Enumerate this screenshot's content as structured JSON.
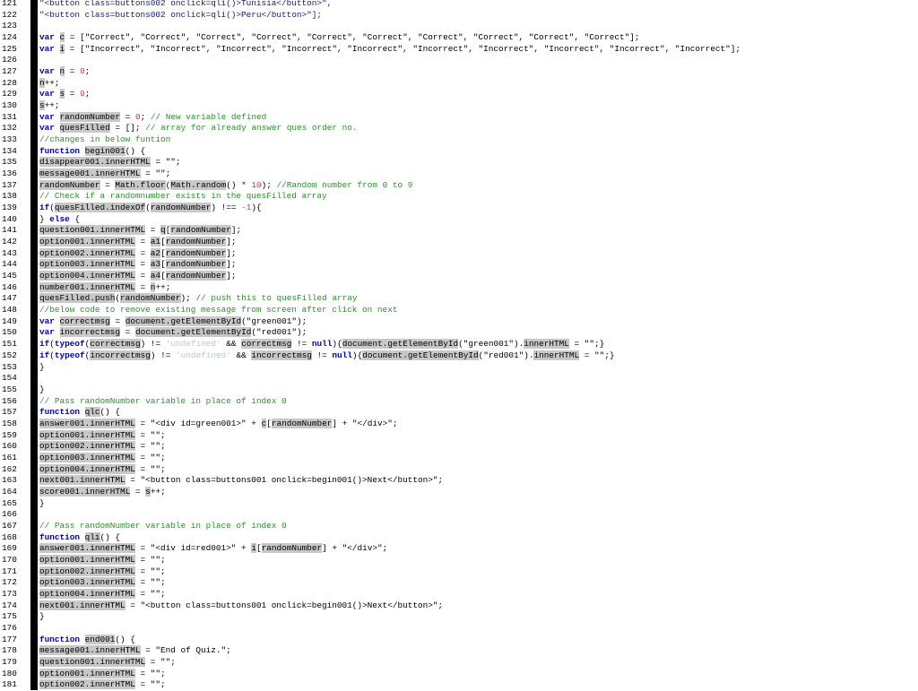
{
  "editor": {
    "lines": [
      {
        "n": "121",
        "code": [
          {
            "t": "\"<button class=buttons002 onclick=qli()>Tunisia</button>\",",
            "c": "str"
          }
        ]
      },
      {
        "n": "122",
        "code": [
          {
            "t": "\"<button class=buttons002 onclick=qli()>Peru</button>\"];",
            "c": "str"
          }
        ]
      },
      {
        "n": "123",
        "code": []
      },
      {
        "n": "124",
        "code": [
          {
            "t": "var",
            "c": "kw"
          },
          {
            "t": " "
          },
          {
            "t": "c",
            "c": "hl"
          },
          {
            "t": " = [\"Correct\", \"Correct\", \"Correct\", \"Correct\", \"Correct\", \"Correct\", \"Correct\", \"Correct\", \"Correct\", \"Correct\"];"
          }
        ]
      },
      {
        "n": "125",
        "code": [
          {
            "t": "var",
            "c": "kw"
          },
          {
            "t": " "
          },
          {
            "t": "i",
            "c": "hl"
          },
          {
            "t": " = [\"Incorrect\", \"Incorrect\", \"Incorrect\", \"Incorrect\", \"Incorrect\", \"Incorrect\", \"Incorrect\", \"Incorrect\", \"Incorrect\", \"Incorrect\"];"
          }
        ]
      },
      {
        "n": "126",
        "code": []
      },
      {
        "n": "127",
        "code": [
          {
            "t": "var",
            "c": "kw"
          },
          {
            "t": " "
          },
          {
            "t": "n",
            "c": "hl"
          },
          {
            "t": " = "
          },
          {
            "t": "0",
            "c": "num"
          },
          {
            "t": ";"
          }
        ]
      },
      {
        "n": "128",
        "code": [
          {
            "t": "n",
            "c": "hl"
          },
          {
            "t": "++;"
          }
        ]
      },
      {
        "n": "129",
        "code": [
          {
            "t": "var",
            "c": "kw"
          },
          {
            "t": " "
          },
          {
            "t": "s",
            "c": "hl"
          },
          {
            "t": " = "
          },
          {
            "t": "0",
            "c": "num"
          },
          {
            "t": ";"
          }
        ]
      },
      {
        "n": "130",
        "code": [
          {
            "t": "s",
            "c": "hl"
          },
          {
            "t": "++;"
          }
        ]
      },
      {
        "n": "131",
        "code": [
          {
            "t": "var",
            "c": "kw"
          },
          {
            "t": " "
          },
          {
            "t": "randomNumber",
            "c": "hl"
          },
          {
            "t": " = "
          },
          {
            "t": "0",
            "c": "num"
          },
          {
            "t": "; "
          },
          {
            "t": "// New variable defined",
            "c": "cm"
          }
        ]
      },
      {
        "n": "132",
        "code": [
          {
            "t": "var",
            "c": "kw"
          },
          {
            "t": " "
          },
          {
            "t": "quesFilled",
            "c": "hl"
          },
          {
            "t": " = []; "
          },
          {
            "t": "// array for already answer ques order no.",
            "c": "cm"
          }
        ]
      },
      {
        "n": "133",
        "code": [
          {
            "t": "//changes in below funtion",
            "c": "cm"
          }
        ]
      },
      {
        "n": "134",
        "code": [
          {
            "t": "function",
            "c": "kw"
          },
          {
            "t": " "
          },
          {
            "t": "begin001",
            "c": "hl"
          },
          {
            "t": "() {"
          }
        ]
      },
      {
        "n": "135",
        "code": [
          {
            "t": "disappear001.innerHTML",
            "c": "hl"
          },
          {
            "t": " = \"\";"
          }
        ]
      },
      {
        "n": "136",
        "code": [
          {
            "t": "message001.innerHTML",
            "c": "hl"
          },
          {
            "t": " = \"\";"
          }
        ]
      },
      {
        "n": "137",
        "code": [
          {
            "t": "randomNumber",
            "c": "hl"
          },
          {
            "t": " = "
          },
          {
            "t": "Math.floor",
            "c": "hl"
          },
          {
            "t": "("
          },
          {
            "t": "Math.random",
            "c": "hl"
          },
          {
            "t": "() * "
          },
          {
            "t": "10",
            "c": "num"
          },
          {
            "t": "); "
          },
          {
            "t": "//Random number from 0 to 9",
            "c": "cm"
          }
        ]
      },
      {
        "n": "138",
        "code": [
          {
            "t": "// Check if a randomnumber exists in the quesFilled array",
            "c": "cm"
          }
        ]
      },
      {
        "n": "139",
        "code": [
          {
            "t": "if",
            "c": "kw"
          },
          {
            "t": "("
          },
          {
            "t": "quesFilled.indexOf",
            "c": "hl"
          },
          {
            "t": "("
          },
          {
            "t": "randomNumber",
            "c": "hl"
          },
          {
            "t": ") !== "
          },
          {
            "t": "-1",
            "c": "num"
          },
          {
            "t": "){"
          }
        ]
      },
      {
        "n": "140",
        "code": [
          {
            "t": "} "
          },
          {
            "t": "else",
            "c": "kw"
          },
          {
            "t": " {"
          }
        ]
      },
      {
        "n": "141",
        "code": [
          {
            "t": "question001.innerHTML",
            "c": "hl"
          },
          {
            "t": " = "
          },
          {
            "t": "q",
            "c": "hl"
          },
          {
            "t": "["
          },
          {
            "t": "randomNumber",
            "c": "hl"
          },
          {
            "t": "];"
          }
        ]
      },
      {
        "n": "142",
        "code": [
          {
            "t": "option001.innerHTML",
            "c": "hl"
          },
          {
            "t": " = "
          },
          {
            "t": "a1",
            "c": "hl"
          },
          {
            "t": "["
          },
          {
            "t": "randomNumber",
            "c": "hl"
          },
          {
            "t": "];"
          }
        ]
      },
      {
        "n": "143",
        "code": [
          {
            "t": "option002.innerHTML",
            "c": "hl"
          },
          {
            "t": " = "
          },
          {
            "t": "a2",
            "c": "hl"
          },
          {
            "t": "["
          },
          {
            "t": "randomNumber",
            "c": "hl"
          },
          {
            "t": "];"
          }
        ]
      },
      {
        "n": "144",
        "code": [
          {
            "t": "option003.innerHTML",
            "c": "hl"
          },
          {
            "t": " = "
          },
          {
            "t": "a3",
            "c": "hl"
          },
          {
            "t": "["
          },
          {
            "t": "randomNumber",
            "c": "hl"
          },
          {
            "t": "];"
          }
        ]
      },
      {
        "n": "145",
        "code": [
          {
            "t": "option004.innerHTML",
            "c": "hl"
          },
          {
            "t": " = "
          },
          {
            "t": "a4",
            "c": "hl"
          },
          {
            "t": "["
          },
          {
            "t": "randomNumber",
            "c": "hl"
          },
          {
            "t": "];"
          }
        ]
      },
      {
        "n": "146",
        "code": [
          {
            "t": "number001.innerHTML",
            "c": "hl"
          },
          {
            "t": " = "
          },
          {
            "t": "n",
            "c": "hl"
          },
          {
            "t": "++;"
          }
        ]
      },
      {
        "n": "147",
        "code": [
          {
            "t": "quesFilled.push",
            "c": "hl"
          },
          {
            "t": "("
          },
          {
            "t": "randomNumber",
            "c": "hl"
          },
          {
            "t": "); "
          },
          {
            "t": "// push this to quesFilled array",
            "c": "cm"
          }
        ]
      },
      {
        "n": "148",
        "code": [
          {
            "t": "//below code to remove existing message from screen after click on next",
            "c": "cm"
          }
        ]
      },
      {
        "n": "149",
        "code": [
          {
            "t": "var",
            "c": "kw"
          },
          {
            "t": " "
          },
          {
            "t": "correctmsg",
            "c": "hl"
          },
          {
            "t": " = "
          },
          {
            "t": "document.getElementById",
            "c": "hl"
          },
          {
            "t": "(\"green001\");"
          }
        ]
      },
      {
        "n": "150",
        "code": [
          {
            "t": "var",
            "c": "kw"
          },
          {
            "t": " "
          },
          {
            "t": "incorrectmsg",
            "c": "hl"
          },
          {
            "t": " = "
          },
          {
            "t": "document.getElementById",
            "c": "hl"
          },
          {
            "t": "(\"red001\");"
          }
        ]
      },
      {
        "n": "151",
        "code": [
          {
            "t": "if",
            "c": "kw"
          },
          {
            "t": "("
          },
          {
            "t": "typeof",
            "c": "kw"
          },
          {
            "t": "("
          },
          {
            "t": "correctmsg",
            "c": "hl"
          },
          {
            "t": ") != "
          },
          {
            "t": "'undefined'",
            "c": "undef"
          },
          {
            "t": " && "
          },
          {
            "t": "correctmsg",
            "c": "hl"
          },
          {
            "t": " != "
          },
          {
            "t": "null",
            "c": "kw"
          },
          {
            "t": "){"
          },
          {
            "t": "document.getElementById",
            "c": "hl"
          },
          {
            "t": "(\"green001\")."
          },
          {
            "t": "innerHTML",
            "c": "hl"
          },
          {
            "t": " = \"\";}"
          }
        ]
      },
      {
        "n": "152",
        "code": [
          {
            "t": "if",
            "c": "kw"
          },
          {
            "t": "("
          },
          {
            "t": "typeof",
            "c": "kw"
          },
          {
            "t": "("
          },
          {
            "t": "incorrectmsg",
            "c": "hl"
          },
          {
            "t": ") != "
          },
          {
            "t": "'undefined'",
            "c": "undef"
          },
          {
            "t": " && "
          },
          {
            "t": "incorrectmsg",
            "c": "hl"
          },
          {
            "t": " != "
          },
          {
            "t": "null",
            "c": "kw"
          },
          {
            "t": "){"
          },
          {
            "t": "document.getElementById",
            "c": "hl"
          },
          {
            "t": "(\"red001\")."
          },
          {
            "t": "innerHTML",
            "c": "hl"
          },
          {
            "t": " = \"\";}"
          }
        ]
      },
      {
        "n": "153",
        "code": [
          {
            "t": "}"
          }
        ]
      },
      {
        "n": "154",
        "code": []
      },
      {
        "n": "155",
        "code": [
          {
            "t": "}"
          }
        ]
      },
      {
        "n": "156",
        "code": [
          {
            "t": "// Pass randomNumber variable in place of index 0",
            "c": "cm"
          }
        ]
      },
      {
        "n": "157",
        "code": [
          {
            "t": "function",
            "c": "kw"
          },
          {
            "t": " "
          },
          {
            "t": "qlc",
            "c": "hl"
          },
          {
            "t": "() {"
          }
        ]
      },
      {
        "n": "158",
        "code": [
          {
            "t": "answer001.innerHTML",
            "c": "hl"
          },
          {
            "t": " = \"<div id=green001>\" + "
          },
          {
            "t": "c",
            "c": "hl"
          },
          {
            "t": "["
          },
          {
            "t": "randomNumber",
            "c": "hl"
          },
          {
            "t": "] + \"</div>\";"
          }
        ]
      },
      {
        "n": "159",
        "code": [
          {
            "t": "option001.innerHTML",
            "c": "hl"
          },
          {
            "t": " = \"\";"
          }
        ]
      },
      {
        "n": "160",
        "code": [
          {
            "t": "option002.innerHTML",
            "c": "hl"
          },
          {
            "t": " = \"\";"
          }
        ]
      },
      {
        "n": "161",
        "code": [
          {
            "t": "option003.innerHTML",
            "c": "hl"
          },
          {
            "t": " = \"\";"
          }
        ]
      },
      {
        "n": "162",
        "code": [
          {
            "t": "option004.innerHTML",
            "c": "hl"
          },
          {
            "t": " = \"\";"
          }
        ]
      },
      {
        "n": "163",
        "code": [
          {
            "t": "next001.innerHTML",
            "c": "hl"
          },
          {
            "t": " = \"<button class=buttons001 onclick=begin001()>Next</button>\";"
          }
        ]
      },
      {
        "n": "164",
        "code": [
          {
            "t": "score001.innerHTML",
            "c": "hl"
          },
          {
            "t": " = "
          },
          {
            "t": "s",
            "c": "hl"
          },
          {
            "t": "++;"
          }
        ]
      },
      {
        "n": "165",
        "code": [
          {
            "t": "}"
          }
        ]
      },
      {
        "n": "166",
        "code": []
      },
      {
        "n": "167",
        "code": [
          {
            "t": "// Pass randomNumber variable in place of index 0",
            "c": "cm"
          }
        ]
      },
      {
        "n": "168",
        "code": [
          {
            "t": "function",
            "c": "kw"
          },
          {
            "t": " "
          },
          {
            "t": "qli",
            "c": "hl"
          },
          {
            "t": "() {"
          }
        ]
      },
      {
        "n": "169",
        "code": [
          {
            "t": "answer001.innerHTML",
            "c": "hl"
          },
          {
            "t": " = \"<div id=red001>\" + "
          },
          {
            "t": "i",
            "c": "hl"
          },
          {
            "t": "["
          },
          {
            "t": "randomNumber",
            "c": "hl"
          },
          {
            "t": "] + \"</div>\";"
          }
        ]
      },
      {
        "n": "170",
        "code": [
          {
            "t": "option001.innerHTML",
            "c": "hl"
          },
          {
            "t": " = \"\";"
          }
        ]
      },
      {
        "n": "171",
        "code": [
          {
            "t": "option002.innerHTML",
            "c": "hl"
          },
          {
            "t": " = \"\";"
          }
        ]
      },
      {
        "n": "172",
        "code": [
          {
            "t": "option003.innerHTML",
            "c": "hl"
          },
          {
            "t": " = \"\";"
          }
        ]
      },
      {
        "n": "173",
        "code": [
          {
            "t": "option004.innerHTML",
            "c": "hl"
          },
          {
            "t": " = \"\";"
          }
        ]
      },
      {
        "n": "174",
        "code": [
          {
            "t": "next001.innerHTML",
            "c": "hl"
          },
          {
            "t": " = \"<button class=buttons001 onclick=begin001()>Next</button>\";"
          }
        ]
      },
      {
        "n": "175",
        "code": [
          {
            "t": "}"
          }
        ]
      },
      {
        "n": "176",
        "code": []
      },
      {
        "n": "177",
        "code": [
          {
            "t": "function",
            "c": "kw"
          },
          {
            "t": " "
          },
          {
            "t": "end001",
            "c": "hl"
          },
          {
            "t": "() {"
          }
        ]
      },
      {
        "n": "178",
        "code": [
          {
            "t": "message001.innerHTML",
            "c": "hl"
          },
          {
            "t": " = \"End of Quiz.\";"
          }
        ]
      },
      {
        "n": "179",
        "code": [
          {
            "t": "question001.innerHTML",
            "c": "hl"
          },
          {
            "t": " = \"\";"
          }
        ]
      },
      {
        "n": "180",
        "code": [
          {
            "t": "option001.innerHTML",
            "c": "hl"
          },
          {
            "t": " = \"\";"
          }
        ]
      },
      {
        "n": "181",
        "code": [
          {
            "t": "option002.innerHTML",
            "c": "hl"
          },
          {
            "t": " = \"\";"
          }
        ]
      }
    ]
  },
  "colors": {
    "keyword": "#0000c0",
    "number": "#e03030",
    "comment": "#2f8f2f",
    "undefined_string": "#b8c8d8",
    "highlight": "#c8c8c8",
    "gutter_bar": "#000000"
  }
}
